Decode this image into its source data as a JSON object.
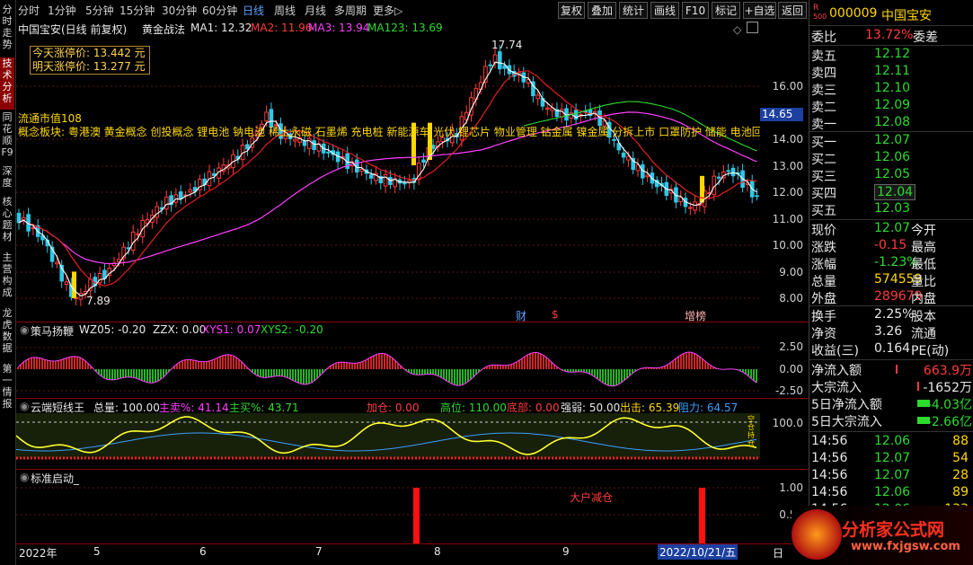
{
  "sidebar": {
    "tabs": [
      "分时走势",
      "技术分析",
      "同花顺F9",
      "深度",
      "核心题材",
      "主营构成",
      "龙虎数据",
      "第一情报"
    ],
    "active": 1
  },
  "toolbar": {
    "periods": [
      "分时",
      "1分钟",
      "5分钟",
      "15分钟",
      "30分钟",
      "60分钟",
      "日线",
      "周线",
      "月线",
      "多周期",
      "更多▷"
    ],
    "active_period": "日线",
    "buttons": [
      "复权",
      "叠加",
      "统计",
      "画线",
      "F10",
      "标记",
      "+自选",
      "返回"
    ]
  },
  "main_chart": {
    "stock_title": "中国宝安(日线 前复权)",
    "indicator_name": "黄金战法",
    "ma1": "MA1: 12.32",
    "ma2": "MA2: 11.96",
    "ma3": "MA3: 13.94",
    "ma123": "MA123: 13.69",
    "limit_up_today": "今天涨停价: 13.442 元",
    "limit_up_tomorrow": "明天涨停价: 13.277 元",
    "circ_cap": "流通市值108",
    "concepts": "概念板块: 粤港澳 黄金概念 创投概念 锂电池 钠电池 稀土永磁 石墨烯 充电桩 新能源车 光伏 锂芯片 物业管理 钴金属 镍金属 分拆上市 口罩防护 储能 电池回收",
    "price_high": "17.74",
    "price_low": "7.89",
    "current_price_tag": "14.65",
    "yaxis": [
      "16.00",
      "15.00",
      "14.00",
      "13.00",
      "12.00",
      "11.00",
      "10.00",
      "9.00",
      "8.00"
    ],
    "markers": {
      "cai": "财",
      "s": "$",
      "zeng": "增榜"
    }
  },
  "pane1": {
    "name": "策马扬鞭",
    "wz05": "WZ05: -0.20",
    "zzx": "ZZX: 0.00",
    "xys1": "XYS1: 0.07",
    "xys2": "XYS2: -0.20",
    "yaxis": [
      "2.50",
      "0.00",
      "-2.50"
    ]
  },
  "pane2": {
    "name": "云端短线王",
    "total": "总量: 100.00",
    "main_sell": "主卖%: 41.14",
    "main_buy": "主买%: 43.71",
    "add": "加仓: 0.00",
    "high": "高位: 110.00",
    "bottom": "底部: 0.00",
    "strength": "强弱: 50.00",
    "out": "出击: 65.39",
    "resist": "阻力: 64.57",
    "yaxis": [
      "100.0"
    ],
    "vert_text": "空仓持仓"
  },
  "pane3": {
    "name": "标准启动_",
    "yaxis": [
      "1.00",
      "0.50"
    ],
    "annotation": "大户减仓"
  },
  "xaxis": {
    "labels": [
      "2022年",
      "5",
      "6",
      "7",
      "8",
      "9"
    ],
    "highlight": "2022/10/21/五",
    "corner": "日"
  },
  "watermark": "分析家公式网",
  "right_panel": {
    "code": "000009",
    "name": "中国宝安",
    "rlabel": "R",
    "rnum": "500",
    "weibi_label": "委比",
    "weibi_val": "13.72%",
    "weicha_label": "委差",
    "asks": [
      {
        "label": "卖五",
        "price": "12.12"
      },
      {
        "label": "卖四",
        "price": "12.11"
      },
      {
        "label": "卖三",
        "price": "12.10"
      },
      {
        "label": "卖二",
        "price": "12.09"
      },
      {
        "label": "卖一",
        "price": "12.08"
      }
    ],
    "bids": [
      {
        "label": "买一",
        "price": "12.07"
      },
      {
        "label": "买二",
        "price": "12.06"
      },
      {
        "label": "买三",
        "price": "12.05"
      },
      {
        "label": "买四",
        "price": "12.04"
      },
      {
        "label": "买五",
        "price": "12.03"
      }
    ],
    "quote": [
      {
        "l1": "现价",
        "v1": "12.07",
        "l2": "今开"
      },
      {
        "l1": "涨跌",
        "v1": "-0.15",
        "l2": "最高"
      },
      {
        "l1": "涨幅",
        "v1": "-1.23%",
        "l2": "最低"
      },
      {
        "l1": "总量",
        "v1": "574559",
        "l2": "量比"
      },
      {
        "l1": "外盘",
        "v1": "289679",
        "l2": "内盘"
      }
    ],
    "quote2": [
      {
        "l1": "换手",
        "v1": "2.25%",
        "l2": "股本"
      },
      {
        "l1": "净资",
        "v1": "3.26",
        "l2": "流通"
      },
      {
        "l1": "收益(三)",
        "v1": "0.164",
        "l2": "PE(动)"
      }
    ],
    "flows": [
      {
        "label": "净流入额",
        "value": "663.9万"
      },
      {
        "label": "大宗流入",
        "value": "-1652万"
      },
      {
        "label": "5日净流入额",
        "value": "-4.03亿"
      },
      {
        "label": "5日大宗流入",
        "value": "-2.66亿"
      }
    ],
    "ticks": [
      {
        "time": "14:56",
        "price": "12.06",
        "vol": "88"
      },
      {
        "time": "14:56",
        "price": "12.07",
        "vol": "54"
      },
      {
        "time": "14:56",
        "price": "12.07",
        "vol": "28"
      },
      {
        "time": "14:56",
        "price": "12.06",
        "vol": "89"
      },
      {
        "time": "14:56",
        "price": "12.06",
        "vol": "133"
      }
    ],
    "logo_text": "分析家公式网",
    "logo_url": "www.fxjgsw.com"
  }
}
